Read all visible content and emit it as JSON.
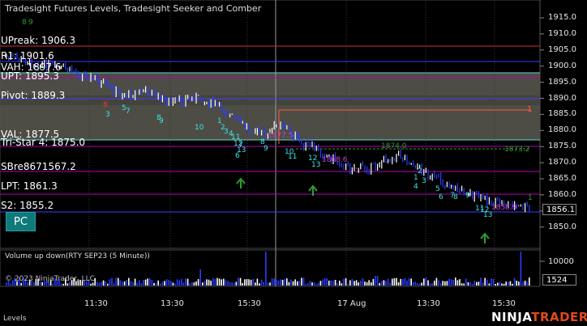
{
  "window": {
    "title": "Tradesight Futures Levels, Tradesight Seeker and Comber",
    "instrument_button": "PC",
    "bottom_tab": "Levels",
    "brand_main": "NINJA",
    "brand_accent": "TRADER"
  },
  "price_panel": {
    "y_axis_ticks": [
      "1915.0",
      "1910.0",
      "1905.0",
      "1900.0",
      "1895.0",
      "1890.0",
      "1885.0",
      "1880.0",
      "1875.0",
      "1870.0",
      "1865.0",
      "1860.0",
      "1855.0",
      "1850.0"
    ],
    "last_price": "1856.1",
    "levels": [
      {
        "label": "UPreak: 1906.3",
        "color": "#ff5a5a"
      },
      {
        "label": "R1: 1901.6",
        "color": "#3c3cff"
      },
      {
        "label": "VAH: 1897.6",
        "color": "#ffffff"
      },
      {
        "label": "UPT: 1895.3",
        "color": "#ffffff"
      },
      {
        "label": "Pivot: 1889.3",
        "color": "#ffffff"
      },
      {
        "label": "VAL: 1877.5",
        "color": "#ffffff"
      },
      {
        "label": "Tri-Star 4: 1875.0",
        "color": "#ffffff"
      },
      {
        "label": "SBre8671567.2",
        "color": "#ffffff"
      },
      {
        "label": "LPT: 1861.3",
        "color": "#ffffff"
      },
      {
        "label": "S2: 1855.2",
        "color": "#ffffff"
      }
    ],
    "annotations": [
      {
        "text": "1",
        "color": "#ff5a36"
      },
      {
        "text": "1874.0",
        "color": "#2e9e2e"
      },
      {
        "text": "1873.2",
        "color": "#2e9e2e"
      },
      {
        "text": "1",
        "color": "#2e9e2e"
      },
      {
        "text": "1877.5",
        "color": "#c73fc7"
      },
      {
        "text": "1868.6",
        "color": "#c73fc7"
      },
      {
        "text": "1858.9",
        "color": "#c73fc7"
      },
      {
        "text": "8",
        "color": "#2e9e2e"
      },
      {
        "text": "9",
        "color": "#2e9e2e"
      }
    ],
    "counts": [
      "3",
      "5",
      "8",
      "7",
      "8",
      "9",
      "10",
      "1",
      "2",
      "3",
      "4",
      "11",
      "12",
      "13",
      "6",
      "7",
      "8",
      "9",
      "10",
      "11",
      "12",
      "13",
      "1",
      "2",
      "3",
      "4",
      "5",
      "6",
      "7",
      "8",
      "9",
      "11",
      "12",
      "13"
    ]
  },
  "volume_panel": {
    "title": "Volume up down(RTY SEP23 (5 Minute))",
    "y_tick": "10000",
    "last_volume": "1524",
    "copyright": "© 2023 NinjaTrader, LLC"
  },
  "x_axis": {
    "ticks": [
      "11:30",
      "13:30",
      "15:30",
      "17 Aug",
      "13:30",
      "15:30"
    ]
  },
  "colors": {
    "background": "#000000",
    "up_bar": "#ffffff",
    "down_bar": "#2a3cff",
    "count_cyan": "#39e6e6",
    "count_red": "#ff3030",
    "count_green": "#2e9e2e",
    "magenta": "#b400b4",
    "band_fill": "#5a5a50"
  }
}
